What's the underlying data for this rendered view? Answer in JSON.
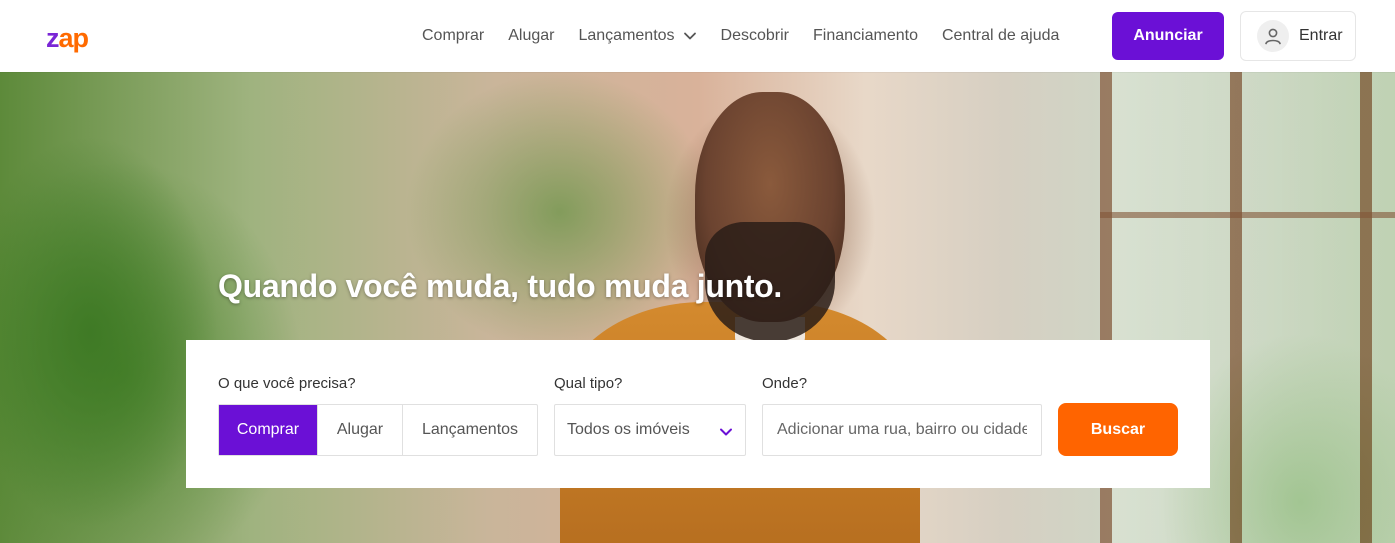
{
  "logo": {
    "part1": "z",
    "part2": "ap"
  },
  "nav": {
    "items": [
      {
        "label": "Comprar"
      },
      {
        "label": "Alugar"
      },
      {
        "label": "Lançamentos"
      },
      {
        "label": "Descobrir"
      },
      {
        "label": "Financiamento"
      },
      {
        "label": "Central de ajuda"
      }
    ],
    "anunciar_label": "Anunciar",
    "entrar_label": "Entrar"
  },
  "hero": {
    "title": "Quando você muda, tudo muda junto."
  },
  "search": {
    "need_label": "O que você precisa?",
    "type_label": "Qual tipo?",
    "where_label": "Onde?",
    "options": [
      "Comprar",
      "Alugar",
      "Lançamentos"
    ],
    "selected_option": "Comprar",
    "type_value": "Todos os imóveis",
    "where_placeholder": "Adicionar uma rua, bairro ou cidade",
    "submit_label": "Buscar"
  },
  "colors": {
    "brand_purple": "#6b10d6",
    "brand_orange": "#ff6400"
  }
}
